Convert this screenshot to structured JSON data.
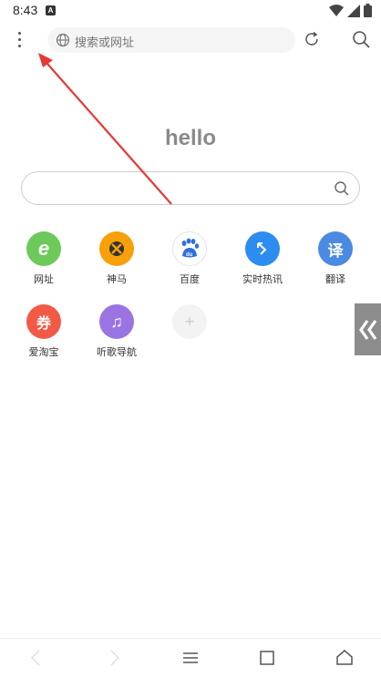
{
  "status_bar": {
    "time": "8:43",
    "notification_glyph": "A",
    "icons": [
      "wifi-icon",
      "signal-icon",
      "battery-icon"
    ]
  },
  "toolbar": {
    "menu_icon": "more-vertical-icon",
    "url_placeholder": "搜索或网址",
    "globe_icon": "globe-icon",
    "refresh_icon": "refresh-icon",
    "search_icon": "search-icon"
  },
  "hero": {
    "title": "hello",
    "search_value": "",
    "search_icon": "search-icon"
  },
  "shortcuts": [
    {
      "label": "网址",
      "glyph": "e",
      "color": "#6cc95a",
      "icon": "browser-e-icon"
    },
    {
      "label": "神马",
      "glyph": "",
      "color": "#f7a00a",
      "icon": "shenma-horse-icon"
    },
    {
      "label": "百度",
      "glyph": "du",
      "color": "#ffffff",
      "icon": "baidu-paw-icon"
    },
    {
      "label": "实时热讯",
      "glyph": "",
      "color": "#2d8cf0",
      "icon": "trending-arrow-icon"
    },
    {
      "label": "翻译",
      "glyph": "译",
      "color": "#4b8ae3",
      "icon": "translate-icon"
    },
    {
      "label": "爱淘宝",
      "glyph": "券",
      "color": "#f25a45",
      "icon": "coupon-icon"
    },
    {
      "label": "听歌导航",
      "glyph": "♫",
      "color": "#9a74e3",
      "icon": "music-note-icon"
    },
    {
      "label": "",
      "glyph": "+",
      "color": "#f3f3f3",
      "icon": "add-shortcut-icon"
    }
  ],
  "side_handle": {
    "icon": "double-chevron-left-icon"
  },
  "bottom_nav": {
    "icons": [
      "back-icon",
      "forward-icon",
      "menu-lines-icon",
      "tabs-square-icon",
      "home-icon"
    ]
  },
  "colors": {
    "annotation_arrow": "#e53935",
    "hello_text": "#8a8a8a",
    "side_handle": "#8c8c8c"
  }
}
